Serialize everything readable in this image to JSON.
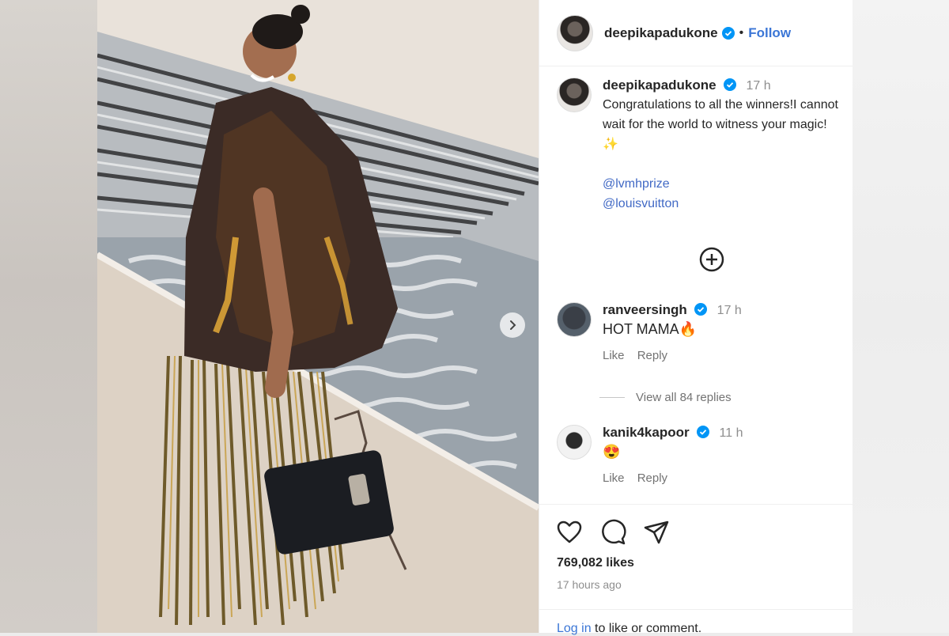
{
  "post": {
    "username": "deepikapadukone",
    "follow_label": "Follow",
    "dot": "•"
  },
  "caption": {
    "username": "deepikapadukone",
    "time": "17 h",
    "text": "Congratulations to all the winners!I cannot wait for the world to witness your magic!✨",
    "mentions": [
      "@lvmhprize",
      "@louisvuitton"
    ]
  },
  "comments": [
    {
      "username": "ranveersingh",
      "time": "17 h",
      "text": "HOT MAMA🔥",
      "like_label": "Like",
      "reply_label": "Reply",
      "view_replies": "View all 84 replies"
    },
    {
      "username": "kanik4kapoor",
      "time": "11 h",
      "text": "😍",
      "like_label": "Like",
      "reply_label": "Reply"
    }
  ],
  "stats": {
    "likes": "769,082 likes",
    "time": "17 hours ago"
  },
  "login": {
    "link": "Log in",
    "rest": " to like or comment."
  },
  "colors": {
    "link_blue": "#3b76d6",
    "verified_blue": "#0095f6",
    "text": "#262626",
    "muted": "#8e8e8e"
  },
  "icons": [
    "chevron-right-icon",
    "verified-icon",
    "add-circle-icon",
    "heart-icon",
    "comment-icon",
    "share-icon"
  ]
}
